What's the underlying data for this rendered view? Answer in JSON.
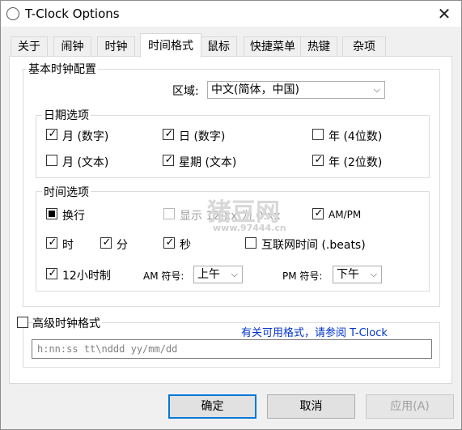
{
  "window": {
    "title": "T-Clock Options",
    "close_glyph": "✕"
  },
  "tabs": [
    {
      "label": "关于"
    },
    {
      "label": "闹钟"
    },
    {
      "label": "时钟"
    },
    {
      "label": "时间格式",
      "active": true
    },
    {
      "label": "鼠标"
    },
    {
      "label": "快捷菜单"
    },
    {
      "label": "热键"
    },
    {
      "label": "杂项"
    }
  ],
  "basic": {
    "legend": "基本时钟配置",
    "region_label": "区域:",
    "region_value": "中文(简体，中国)"
  },
  "date_options": {
    "legend": "日期选项",
    "items": [
      {
        "label": "月 (数字)",
        "checked": true
      },
      {
        "label": "日 (数字)",
        "checked": true
      },
      {
        "label": "年 (4位数)",
        "checked": false
      },
      {
        "label": "月 (文本)",
        "checked": false
      },
      {
        "label": "星期 (文本)",
        "checked": true
      },
      {
        "label": "年 (2位数)",
        "checked": true
      }
    ]
  },
  "time_options": {
    "legend": "时间选项",
    "newline_label": "换行",
    "display_label": "显示 12:xx 为 0:xx",
    "ampm_label": "AM/PM",
    "hour_label": "时",
    "minute_label": "分",
    "second_label": "秒",
    "internet_time_label": "互联网时间 (.beats)",
    "twelve_hour_label": "12小时制",
    "am_label": "AM 符号:",
    "am_value": "上午",
    "pm_label": "PM 符号:",
    "pm_value": "下午"
  },
  "advanced": {
    "label": "高级时钟格式",
    "help_link": "有关可用格式，请参阅 T-Clock",
    "format_value": "h:nn:ss tt\\nddd yy/mm/dd"
  },
  "buttons": {
    "ok": "确定",
    "cancel": "取消",
    "apply": "应用(A)"
  },
  "watermark": {
    "text": "猪豆网",
    "url": "www.97444.cn"
  },
  "colors": {
    "accent": "#0078d7",
    "link": "#0033cc"
  }
}
